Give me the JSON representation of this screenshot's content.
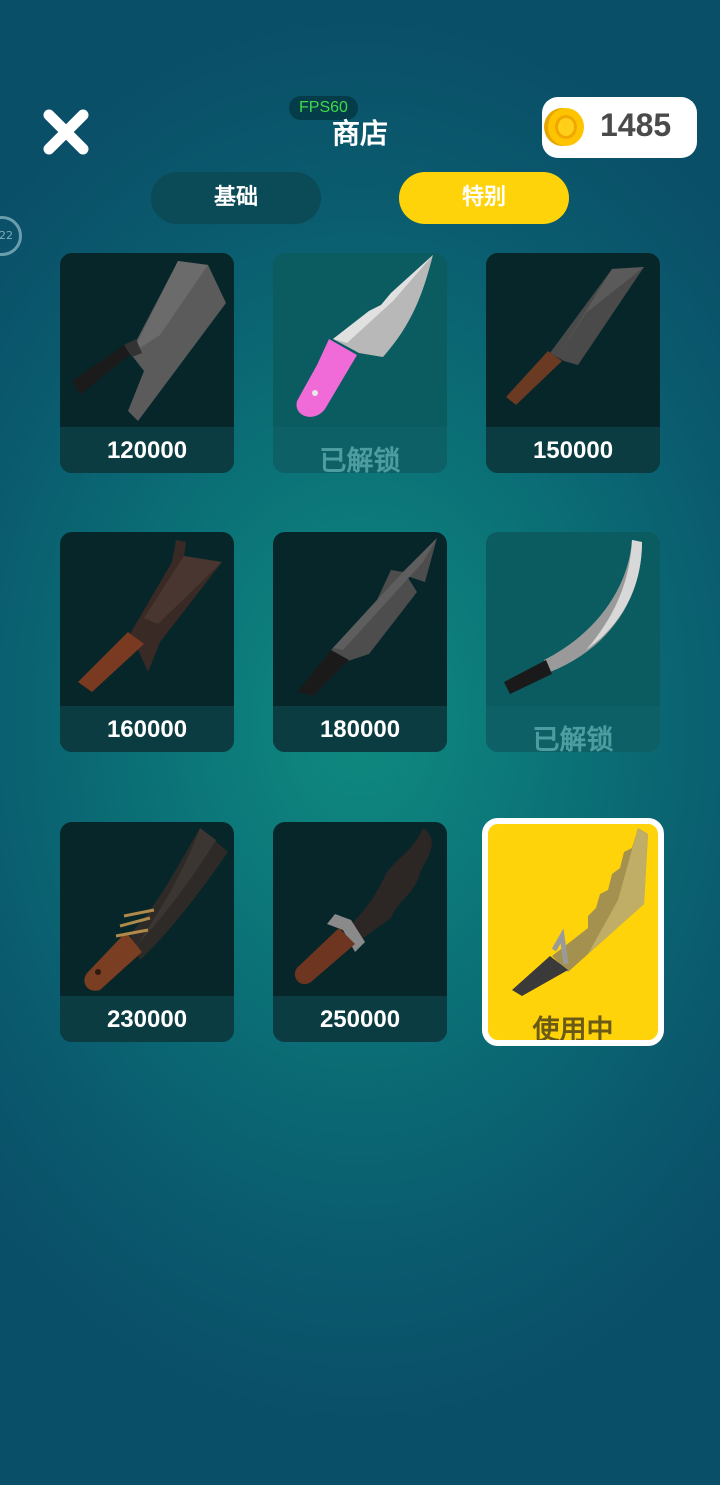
{
  "header": {
    "title": "商店",
    "fps_label": "FPS60",
    "coins": "1485",
    "side_badge": "22"
  },
  "tabs": [
    {
      "label": "基础",
      "active": false
    },
    {
      "label": "特别",
      "active": true
    }
  ],
  "items": [
    {
      "label": "120000",
      "state": "locked",
      "icon": "cleaver-knife-icon"
    },
    {
      "label": "已解锁",
      "state": "unlocked",
      "icon": "pink-handle-knife-icon"
    },
    {
      "label": "150000",
      "state": "locked",
      "icon": "chef-knife-icon"
    },
    {
      "label": "160000",
      "state": "locked",
      "icon": "hooked-cleaver-icon"
    },
    {
      "label": "180000",
      "state": "locked",
      "icon": "barbed-blade-icon"
    },
    {
      "label": "已解锁",
      "state": "unlocked",
      "icon": "curved-saber-icon"
    },
    {
      "label": "230000",
      "state": "locked",
      "icon": "rusty-machete-icon"
    },
    {
      "label": "250000",
      "state": "locked",
      "icon": "wavy-kris-icon"
    },
    {
      "label": "使用中",
      "state": "in-use",
      "icon": "serrated-golden-blade-icon"
    }
  ],
  "colors": {
    "accent": "#ffd30a",
    "tab_inactive": "#0b4a57",
    "fps_text": "#3ddc4a"
  }
}
